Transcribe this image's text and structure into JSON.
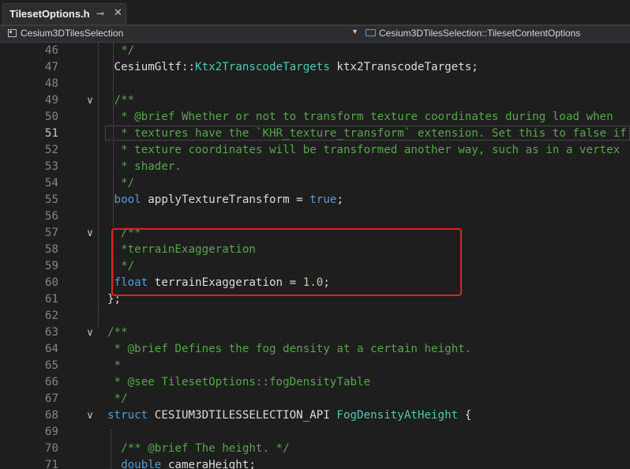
{
  "tab": {
    "title": "TilesetOptions.h",
    "pin_glyph": "⊸",
    "close_glyph": "✕"
  },
  "navbar": {
    "project": "Cesium3DTilesSelection",
    "dropdown_glyph": "▾",
    "scope": "Cesium3DTilesSelection::TilesetContentOptions"
  },
  "colors": {
    "background": "#1e1e1e",
    "comment": "#57a64a",
    "keyword": "#569cd6",
    "type": "#4ec9b0",
    "number": "#b5cea8",
    "highlight_box": "#e02020"
  },
  "current_line": "51",
  "lines": [
    {
      "n": "46",
      "fold": "",
      "segs": [
        {
          "c": "cm",
          "t": "  */"
        }
      ]
    },
    {
      "n": "47",
      "fold": "",
      "segs": [
        {
          "c": "",
          "t": " CesiumGltf::"
        },
        {
          "c": "ty",
          "t": "Ktx2TranscodeTargets"
        },
        {
          "c": "",
          "t": " ktx2TranscodeTargets;"
        }
      ]
    },
    {
      "n": "48",
      "fold": "",
      "segs": []
    },
    {
      "n": "49",
      "fold": "∨",
      "segs": [
        {
          "c": "cm",
          "t": " /**"
        }
      ]
    },
    {
      "n": "50",
      "fold": "",
      "segs": [
        {
          "c": "cm",
          "t": "  * @brief Whether or not to transform texture coordinates during load when"
        }
      ]
    },
    {
      "n": "51",
      "fold": "",
      "segs": [
        {
          "c": "cm",
          "t": "  * textures have the `KHR_texture_transform` extension. Set this to false if"
        }
      ]
    },
    {
      "n": "52",
      "fold": "",
      "segs": [
        {
          "c": "cm",
          "t": "  * texture coordinates will be transformed another way, such as in a vertex"
        }
      ]
    },
    {
      "n": "53",
      "fold": "",
      "segs": [
        {
          "c": "cm",
          "t": "  * shader."
        }
      ]
    },
    {
      "n": "54",
      "fold": "",
      "segs": [
        {
          "c": "cm",
          "t": "  */"
        }
      ]
    },
    {
      "n": "55",
      "fold": "",
      "segs": [
        {
          "c": "kw",
          "t": " bool"
        },
        {
          "c": "",
          "t": " applyTextureTransform = "
        },
        {
          "c": "kw",
          "t": "true"
        },
        {
          "c": "",
          "t": ";"
        }
      ]
    },
    {
      "n": "56",
      "fold": "",
      "segs": []
    },
    {
      "n": "57",
      "fold": "∨",
      "segs": [
        {
          "c": "cm",
          "t": "  /**"
        }
      ]
    },
    {
      "n": "58",
      "fold": "",
      "segs": [
        {
          "c": "cm",
          "t": "  *terrainExaggeration"
        }
      ]
    },
    {
      "n": "59",
      "fold": "",
      "segs": [
        {
          "c": "cm",
          "t": "  */"
        }
      ]
    },
    {
      "n": "60",
      "fold": "",
      "segs": [
        {
          "c": "kw",
          "t": " float"
        },
        {
          "c": "",
          "t": " terrainExaggeration = "
        },
        {
          "c": "num",
          "t": "1.0"
        },
        {
          "c": "",
          "t": ";"
        }
      ]
    },
    {
      "n": "61",
      "fold": "",
      "segs": [
        {
          "c": "",
          "t": "};"
        }
      ]
    },
    {
      "n": "62",
      "fold": "",
      "segs": []
    },
    {
      "n": "63",
      "fold": "∨",
      "segs": [
        {
          "c": "cm",
          "t": "/**"
        }
      ]
    },
    {
      "n": "64",
      "fold": "",
      "segs": [
        {
          "c": "cm",
          "t": " * @brief Defines the fog density at a certain height."
        }
      ]
    },
    {
      "n": "65",
      "fold": "",
      "segs": [
        {
          "c": "cm",
          "t": " *"
        }
      ]
    },
    {
      "n": "66",
      "fold": "",
      "segs": [
        {
          "c": "cm",
          "t": " * @see TilesetOptions::fogDensityTable"
        }
      ]
    },
    {
      "n": "67",
      "fold": "",
      "segs": [
        {
          "c": "cm",
          "t": " */"
        }
      ]
    },
    {
      "n": "68",
      "fold": "∨",
      "segs": [
        {
          "c": "kw",
          "t": "struct"
        },
        {
          "c": "",
          "t": " CESIUM3DTILESSELECTION_API "
        },
        {
          "c": "ty",
          "t": "FogDensityAtHeight"
        },
        {
          "c": "",
          "t": " {"
        }
      ]
    },
    {
      "n": "69",
      "fold": "",
      "segs": []
    },
    {
      "n": "70",
      "fold": "",
      "segs": [
        {
          "c": "cm",
          "t": "  /** @brief The height. */"
        }
      ]
    },
    {
      "n": "71",
      "fold": "",
      "segs": [
        {
          "c": "kw",
          "t": "  double"
        },
        {
          "c": "",
          "t": " cameraHeight;"
        }
      ]
    }
  ]
}
